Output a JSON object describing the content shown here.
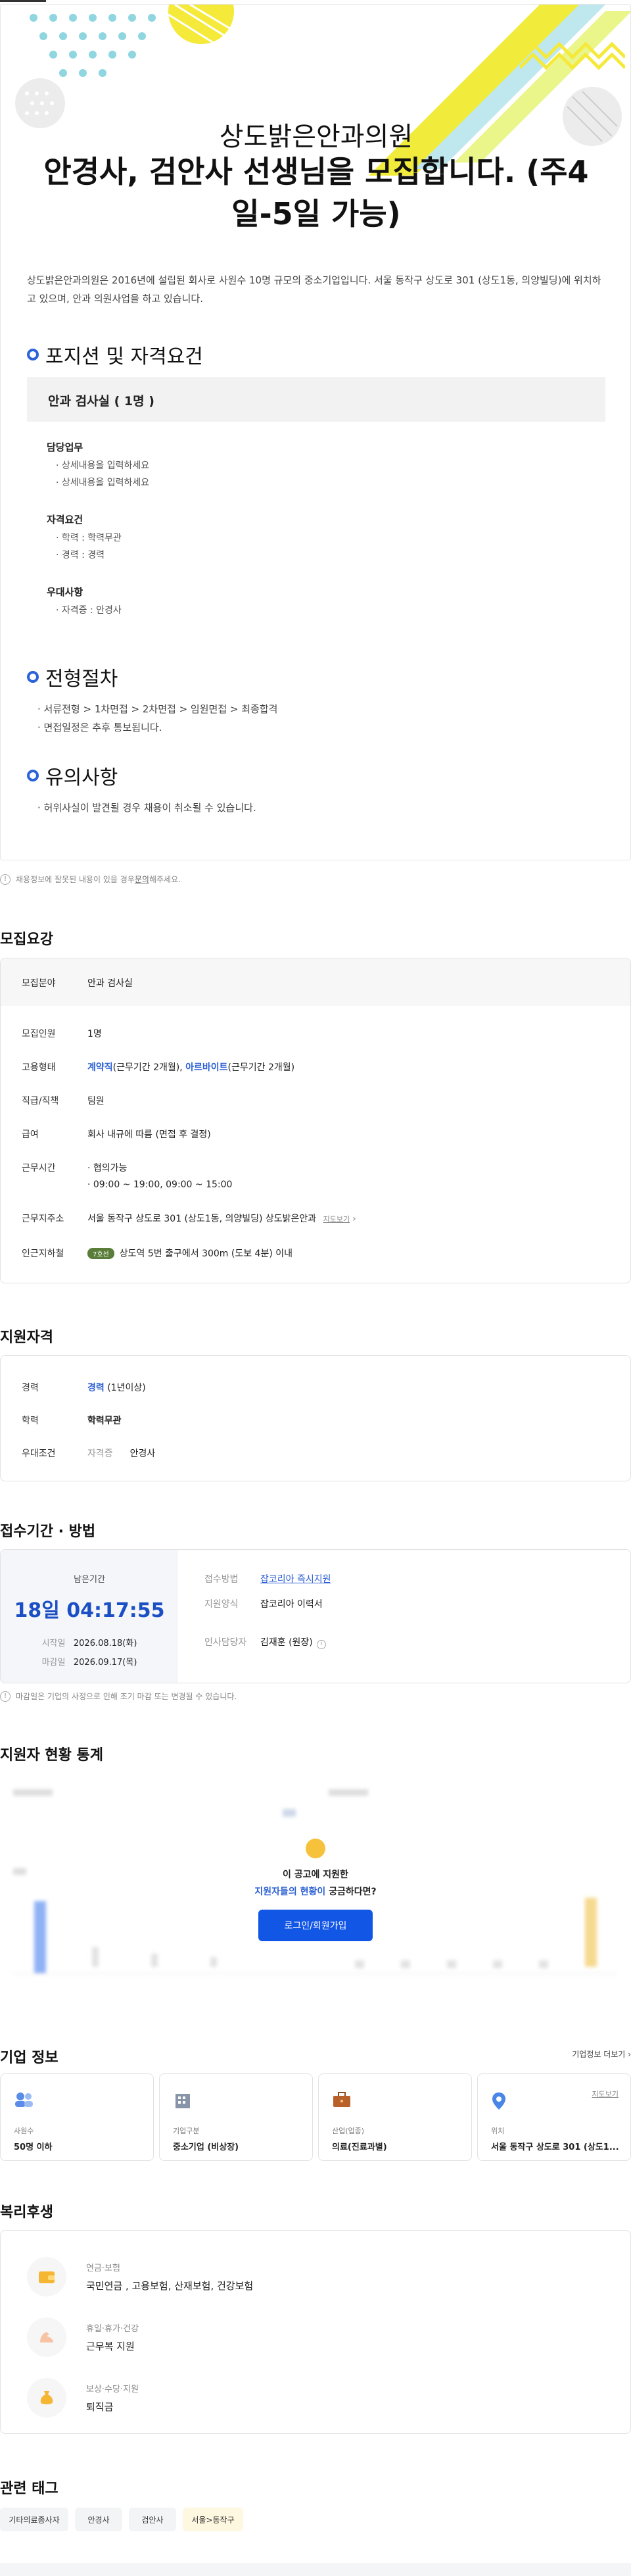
{
  "poster": {
    "company": "상도밝은안과의원",
    "title": "안경사, 검안사 선생님을 모집합니다. (주4일-5일 가능)",
    "intro": "상도밝은안과의원은 2016년에 설립된 회사로 사원수 10명 규모의 중소기업입니다. 서울 동작구 상도로 301 (상도1동, 의양빌딩)에 위치하고 있으며, 안과 의원사업을 하고 있습니다.",
    "section_position": "포지션 및 자격요건",
    "position_box": "안과 검사실 ( 1명 )",
    "duty_label": "담당업무",
    "duty_lines": [
      "· 상세내용을 입력하세요",
      "· 상세내용을 입력하세요"
    ],
    "req_label": "자격요건",
    "req_lines": [
      "· 학력 : 학력무관",
      "· 경력 : 경력"
    ],
    "pref_label": "우대사항",
    "pref_lines": [
      "· 자격증 : 안경사"
    ],
    "section_process": "전형절차",
    "process_lines": [
      "· 서류전형 > 1차면접 > 2차면접 > 임원면접 > 최종합격",
      "· 면접일정은 추후 통보됩니다."
    ],
    "section_notes": "유의사항",
    "notes_lines": [
      "· 허위사실이 발견될 경우 채용이 취소될 수 있습니다."
    ]
  },
  "notice": {
    "text_before": "채용정보에 잘못된 내용이 있을 경우 ",
    "link": "문의",
    "text_after": "해주세요."
  },
  "recruit": {
    "title": "모집요강",
    "rows": {
      "field_k": "모집분야",
      "field_v": "안과 검사실",
      "count_k": "모집인원",
      "count_v": "1명",
      "type_k": "고용형태",
      "type_v1": "계약직",
      "type_v1b": "(근무기간 2개월), ",
      "type_v2": "아르바이트",
      "type_v2b": "(근무기간 2개월)",
      "rank_k": "직급/직책",
      "rank_v": "팀원",
      "pay_k": "급여",
      "pay_v": "회사 내규에 따름 (면접 후 결정)",
      "time_k": "근무시간",
      "time_v1": "· 협의가능",
      "time_v2": "· 09:00 ~ 19:00, 09:00 ~ 15:00",
      "addr_k": "근무지주소",
      "addr_v": "서울 동작구 상도로 301 (상도1동, 의양빌딩) 상도밝은안과",
      "addr_link": "지도보기",
      "subway_k": "인근지하철",
      "subway_line": "7호선",
      "subway_v": "상도역 5번 출구에서 300m (도보 4분) 이내"
    }
  },
  "qualify": {
    "title": "지원자격",
    "exp_k": "경력",
    "exp_v": "경력",
    "exp_note": "(1년이상)",
    "edu_k": "학력",
    "edu_v": "학력무관",
    "pref_k": "우대조건",
    "pref_cat": "자격증",
    "pref_v": "안경사"
  },
  "apply": {
    "title": "접수기간 · 방법",
    "remain_label": "남은기간",
    "remain": "18일 04:17:55",
    "start_k": "시작일",
    "start_v": "2026.08.18(화)",
    "end_k": "마감일",
    "end_v": "2026.09.17(목)",
    "method_k": "접수방법",
    "method_v": "잡코리아 즉시지원",
    "form_k": "지원양식",
    "form_v": "잡코리아 이력서",
    "manager_k": "인사담당자",
    "manager_v": "김재훈 (원장)",
    "note": "마감일은 기업의 사정으로 인해 조기 마감 또는 변경될 수 있습니다."
  },
  "stats": {
    "title": "지원자 현황 통계",
    "line1": "이 공고에 지원한",
    "line2_blue": "지원자들의 현황이",
    "line2_rest": " 궁금하다면?",
    "login_button": "로그인/회원가입"
  },
  "company": {
    "title": "기업 정보",
    "more": "기업정보 더보기",
    "cards": [
      {
        "label": "사원수",
        "value": "50명 이하",
        "icon": "people-icon"
      },
      {
        "label": "기업구분",
        "value": "중소기업 (비상장)",
        "icon": "building-icon"
      },
      {
        "label": "산업(업종)",
        "value": "의료(진료과별)",
        "icon": "briefcase-icon"
      },
      {
        "label": "위치",
        "value": "서울 동작구 상도로 301 (상도1...",
        "icon": "location-icon",
        "link": "지도보기"
      }
    ]
  },
  "welfare": {
    "title": "복리후생",
    "items": [
      {
        "title": "연금·보험",
        "value": "국민연금 , 고용보험, 산재보험, 건강보험"
      },
      {
        "title": "휴일·휴가·건강",
        "value": "근무복 지원"
      },
      {
        "title": "보상·수당·지원",
        "value": "퇴직금"
      }
    ]
  },
  "tags": {
    "title": "관련 태그",
    "items": [
      "기타의료종사자",
      "안경사",
      "검안사",
      "서울>동작구"
    ]
  },
  "colors": {
    "accent": "#2b5fd3",
    "button": "#1256e6",
    "deco_yellow": "#f5e93a",
    "deco_cyan": "#8fd6e0"
  }
}
